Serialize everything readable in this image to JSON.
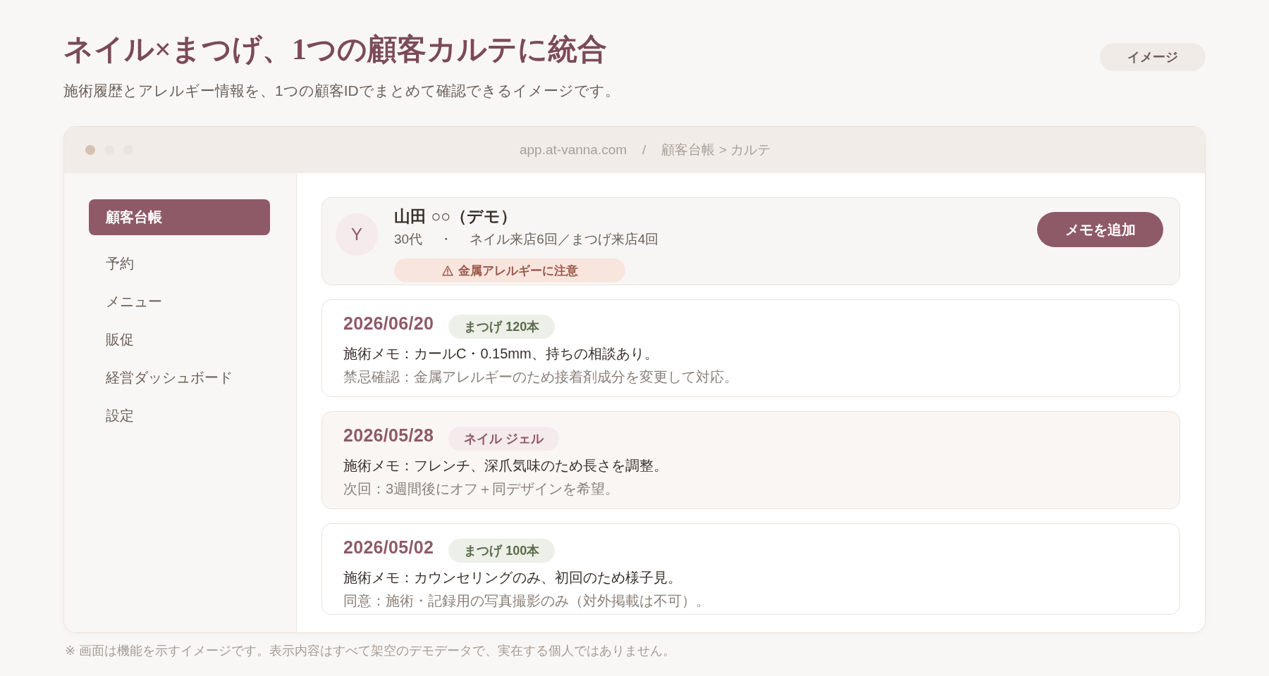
{
  "header": {
    "title": "ネイル×まつげ、1つの顧客カルテに統合",
    "subtitle": "施術履歴とアレルギー情報を、1つの顧客IDでまとめて確認できるイメージです。",
    "badge": "イメージ"
  },
  "window": {
    "address_bar": {
      "url": "app.at-vanna.com",
      "separator": "/",
      "breadcrumb": "顧客台帳 > カルテ"
    }
  },
  "sidebar": {
    "items": [
      {
        "label": "顧客台帳",
        "selected": true
      },
      {
        "label": "予約",
        "selected": false
      },
      {
        "label": "メニュー",
        "selected": false
      },
      {
        "label": "販促",
        "selected": false
      },
      {
        "label": "経営ダッシュボード",
        "selected": false
      },
      {
        "label": "設定",
        "selected": false
      }
    ]
  },
  "customer": {
    "avatar": "Y",
    "name": "山田 ○○（デモ）",
    "meta": [
      "30代",
      "・",
      "ネイル来店6回／まつげ来店4回"
    ],
    "alert": "金属アレルギーに注意",
    "add_memo_button": "メモを追加"
  },
  "records": [
    {
      "kind": "lash",
      "date": "2026/06/20",
      "tag": "まつげ 120本",
      "memo": "施術メモ：カールC・0.15mm、持ちの相談あり。",
      "note": "禁忌確認：金属アレルギーのため接着剤成分を変更して対応。"
    },
    {
      "kind": "nail",
      "date": "2026/05/28",
      "tag": "ネイル ジェル",
      "memo": "施術メモ：フレンチ、深爪気味のため長さを調整。",
      "note": "次回：3週間後にオフ＋同デザインを希望。"
    },
    {
      "kind": "lash",
      "date": "2026/05/02",
      "tag": "まつげ 100本",
      "memo": "施術メモ：カウンセリングのみ、初回のため様子見。",
      "note": "同意：施術・記録用の写真撮影のみ（対外掲載は不可）。"
    }
  ],
  "footer": "※ 画面は機能を示すイメージです。表示内容はすべて架空のデモデータで、実在する個人ではありません。"
}
